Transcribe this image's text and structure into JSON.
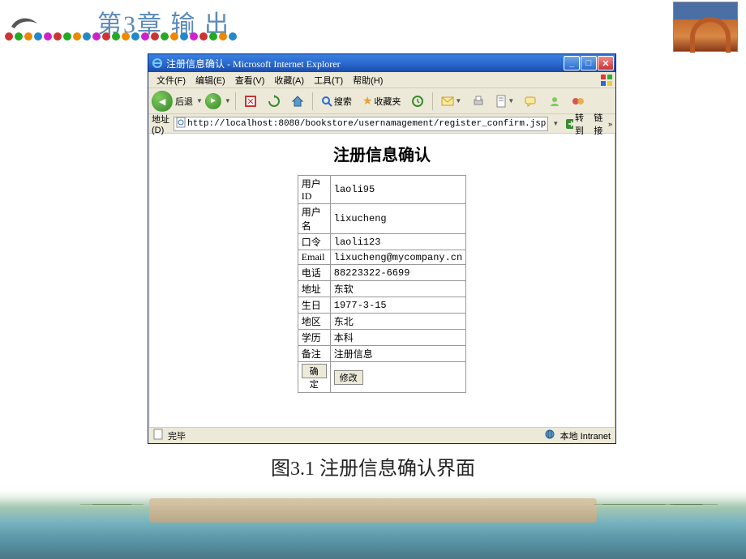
{
  "chapter_title": "第3章   输   出",
  "dot_colors": [
    "#c33",
    "#2a2",
    "#e80",
    "#28c",
    "#c2c",
    "#c33",
    "#2a2",
    "#e80",
    "#28c",
    "#c2c",
    "#c33",
    "#2a2",
    "#e80",
    "#28c",
    "#c2c",
    "#c33",
    "#2a2",
    "#e80",
    "#28c",
    "#c2c",
    "#c33",
    "#2a2",
    "#e80",
    "#28c"
  ],
  "browser": {
    "title": "注册信息确认 - Microsoft Internet Explorer",
    "menus": [
      "文件(F)",
      "编辑(E)",
      "查看(V)",
      "收藏(A)",
      "工具(T)",
      "帮助(H)"
    ],
    "toolbar": {
      "back": "后退",
      "search": "搜索",
      "favorites": "收藏夹"
    },
    "address": {
      "label": "地址(D)",
      "url": "http://localhost:8080/bookstore/usernamagement/register_confirm.jsp",
      "go": "转到",
      "links": "链接"
    },
    "page": {
      "heading": "注册信息确认",
      "rows": [
        {
          "label": "用户ID",
          "value": "laoli95"
        },
        {
          "label": "用户名",
          "value": "lixucheng"
        },
        {
          "label": "口令",
          "value": "laoli123"
        },
        {
          "label": "Email",
          "value": "lixucheng@mycompany.cn"
        },
        {
          "label": "电话",
          "value": "88223322-6699"
        },
        {
          "label": "地址",
          "value": "东软"
        },
        {
          "label": "生日",
          "value": "1977-3-15"
        },
        {
          "label": "地区",
          "value": "东北"
        },
        {
          "label": "学历",
          "value": "本科"
        },
        {
          "label": "备注",
          "value": "注册信息"
        }
      ],
      "btn_confirm": "确定",
      "btn_modify": "修改"
    },
    "status": {
      "done": "完毕",
      "zone": "本地 Intranet"
    }
  },
  "figure_caption": "图3.1 注册信息确认界面"
}
